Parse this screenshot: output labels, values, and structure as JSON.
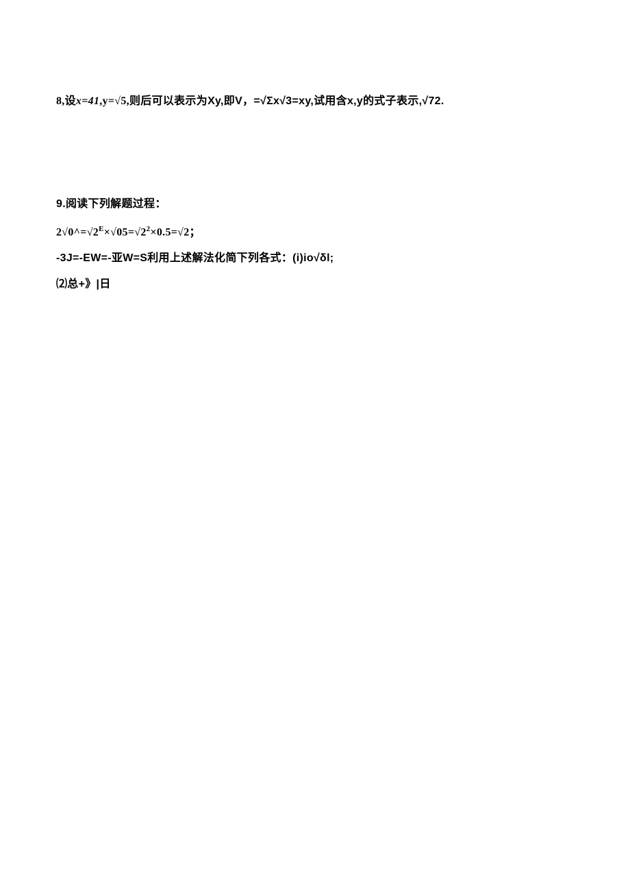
{
  "problem8": {
    "prefix": "8,",
    "text_set": "设",
    "expr1_a": "x=41",
    "expr1_b": ",y=",
    "expr1_c": "√5,",
    "text_then": "则后可以表示为Xy,即V，=√Σx√3=xy,",
    "text_try": "试用含x,y的式子表示,√72."
  },
  "problem9": {
    "header": "9.阅读下列解题过程：",
    "line_a": "2√0^=√2",
    "line_a_sup": "E",
    "line_a_tail": "×√05=√2",
    "line_a_sup2": "2",
    "line_a_tail2": "×0.5=√2；",
    "line_b": "-3J=-EW=-亚W=S利用上述解法化简下列各式：(i)io√δl;",
    "line_c": "⑵总+》|日"
  }
}
